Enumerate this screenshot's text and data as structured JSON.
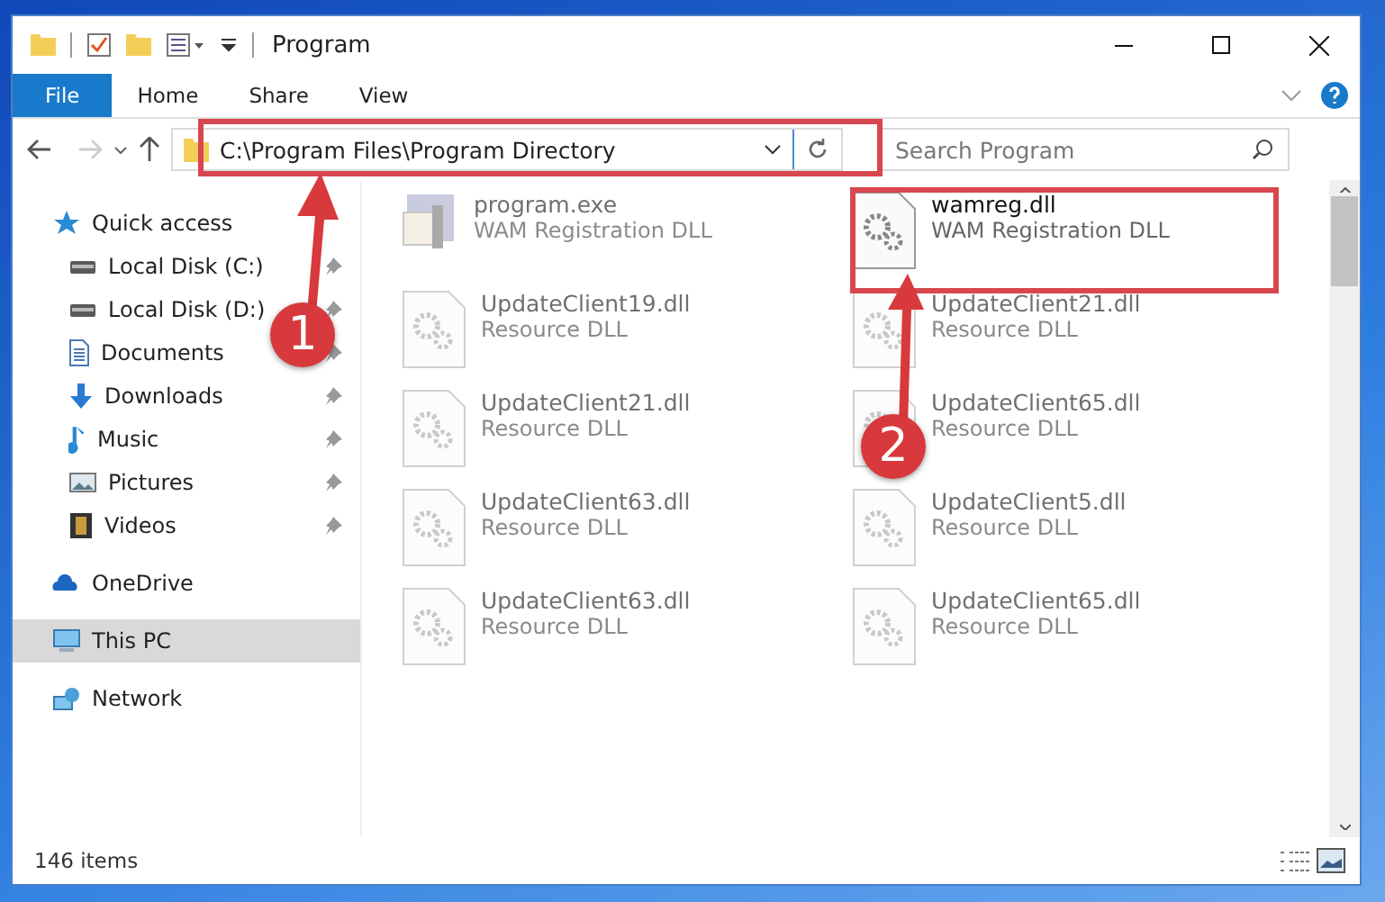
{
  "window": {
    "title": "Program"
  },
  "ribbon_tabs": [
    {
      "label": "File",
      "selected": true
    },
    {
      "label": "Home",
      "selected": false
    },
    {
      "label": "Share",
      "selected": false
    },
    {
      "label": "View",
      "selected": false
    }
  ],
  "address": {
    "path": "C:\\Program Files\\Program Directory"
  },
  "search": {
    "placeholder": "Search Program"
  },
  "sidebar": {
    "items": [
      {
        "label": "Quick access",
        "selected": false,
        "children": [
          {
            "label": "Local Disk (C:)",
            "pinned": true,
            "selected": false
          },
          {
            "label": "Local Disk (D:)",
            "pinned": true,
            "selected": false
          },
          {
            "label": "Documents",
            "pinned": true,
            "selected": false
          },
          {
            "label": "Downloads",
            "pinned": true,
            "selected": false
          },
          {
            "label": "Music",
            "pinned": true,
            "selected": false
          },
          {
            "label": "Pictures",
            "pinned": true,
            "selected": false
          },
          {
            "label": "Videos",
            "pinned": true,
            "selected": false
          }
        ]
      },
      {
        "label": "OneDrive",
        "selected": false
      },
      {
        "label": "This PC",
        "selected": true
      },
      {
        "label": "Network",
        "selected": false
      }
    ]
  },
  "files": [
    {
      "kind": "program",
      "name": "program.exe",
      "type": "WAM Registration DLL",
      "dimmed": true
    },
    {
      "kind": "library",
      "name": "wamreg.dll",
      "type": "WAM Registration DLL",
      "dimmed": false
    },
    {
      "kind": "library",
      "name": "UpdateClient19.dll",
      "type": "Resource DLL",
      "dimmed": true
    },
    {
      "kind": "library",
      "name": "UpdateClient21.dll",
      "type": "Resource DLL",
      "dimmed": true
    },
    {
      "kind": "library",
      "name": "UpdateClient21.dll",
      "type": "Resource DLL",
      "dimmed": true
    },
    {
      "kind": "library",
      "name": "UpdateClient65.dll",
      "type": "Resource DLL",
      "dimmed": true
    },
    {
      "kind": "library",
      "name": "UpdateClient63.dll",
      "type": "Resource DLL",
      "dimmed": true
    },
    {
      "kind": "library",
      "name": "UpdateClient5.dll",
      "type": "Resource DLL",
      "dimmed": true
    },
    {
      "kind": "library",
      "name": "UpdateClient63.dll",
      "type": "Resource DLL",
      "dimmed": true
    },
    {
      "kind": "library",
      "name": "UpdateClient65.dll",
      "type": "Resource DLL",
      "dimmed": true
    }
  ],
  "status_bar": {
    "text": "146 items"
  },
  "annotations": [
    {
      "number": "1"
    },
    {
      "number": "2"
    }
  ]
}
